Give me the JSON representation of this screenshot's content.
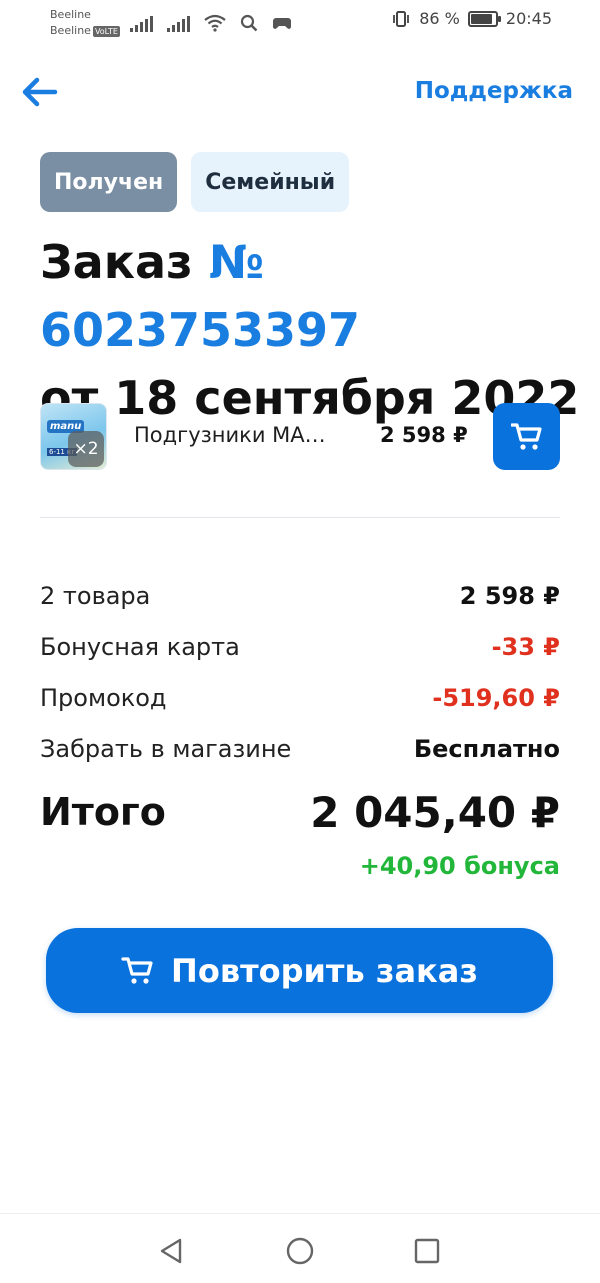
{
  "status_bar": {
    "carrier1": "Beeline",
    "carrier2": "Beeline",
    "volte": "VoLTE",
    "battery_text": "86 %",
    "battery_level": 0.86,
    "time": "20:45"
  },
  "header": {
    "back_icon": "arrow-left-icon",
    "support_label": "Поддержка"
  },
  "chips": {
    "status": "Получен",
    "type": "Семейный"
  },
  "order": {
    "title_prefix": "Заказ ",
    "number": "№ 6023753397",
    "date": "от 18 сентября 2022"
  },
  "product": {
    "thumb_logo": "manu",
    "thumb_size": "6-11 кг",
    "qty": "×2",
    "name": "Подгузники МА…",
    "price": "2 598 ₽",
    "cart_icon": "cart-icon"
  },
  "summary": {
    "rows": [
      {
        "label": "2 товара",
        "value": "2 598 ₽",
        "negative": false
      },
      {
        "label": "Бонусная карта",
        "value": "-33 ₽",
        "negative": true
      },
      {
        "label": "Промокод",
        "value": "-519,60 ₽",
        "negative": true
      },
      {
        "label": "Забрать в магазине",
        "value": "Бесплатно",
        "negative": false
      }
    ],
    "total_label": "Итого",
    "total_value": "2 045,40 ₽",
    "bonus": "+40,90 бонуса"
  },
  "actions": {
    "repeat_label": "Повторить заказ"
  },
  "colors": {
    "accent": "#1a7de0",
    "button": "#0a72dd",
    "negative": "#e0301e",
    "bonus": "#22b63a",
    "chip_status": "#7a8fa3"
  }
}
